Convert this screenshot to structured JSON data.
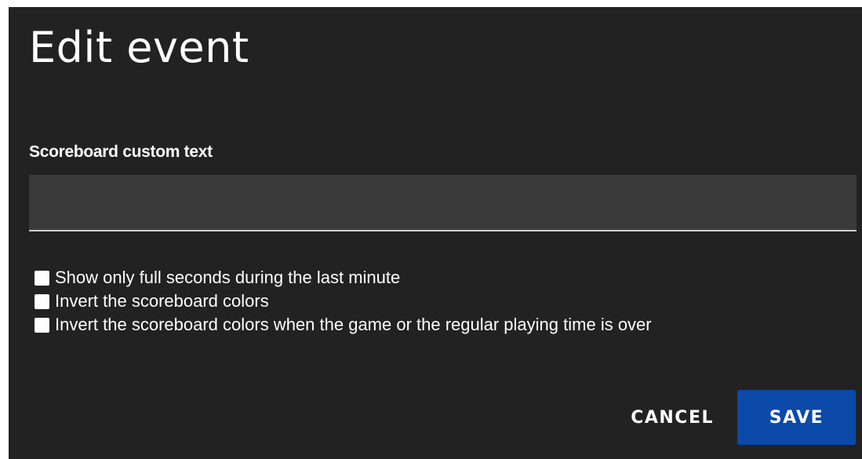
{
  "dialog": {
    "title": "Edit event",
    "field_label": "Scoreboard custom text",
    "field_value": "",
    "options": [
      {
        "label": "Show only full seconds during the last minute",
        "checked": false
      },
      {
        "label": "Invert the scoreboard colors",
        "checked": false
      },
      {
        "label": "Invert the scoreboard colors when the game or the regular playing time is over",
        "checked": false
      }
    ],
    "cancel_label": "CANCEL",
    "save_label": "SAVE"
  },
  "colors": {
    "background": "#222222",
    "input_background": "#3a3a3a",
    "accent": "#0b4aa8",
    "text": "#ffffff"
  }
}
